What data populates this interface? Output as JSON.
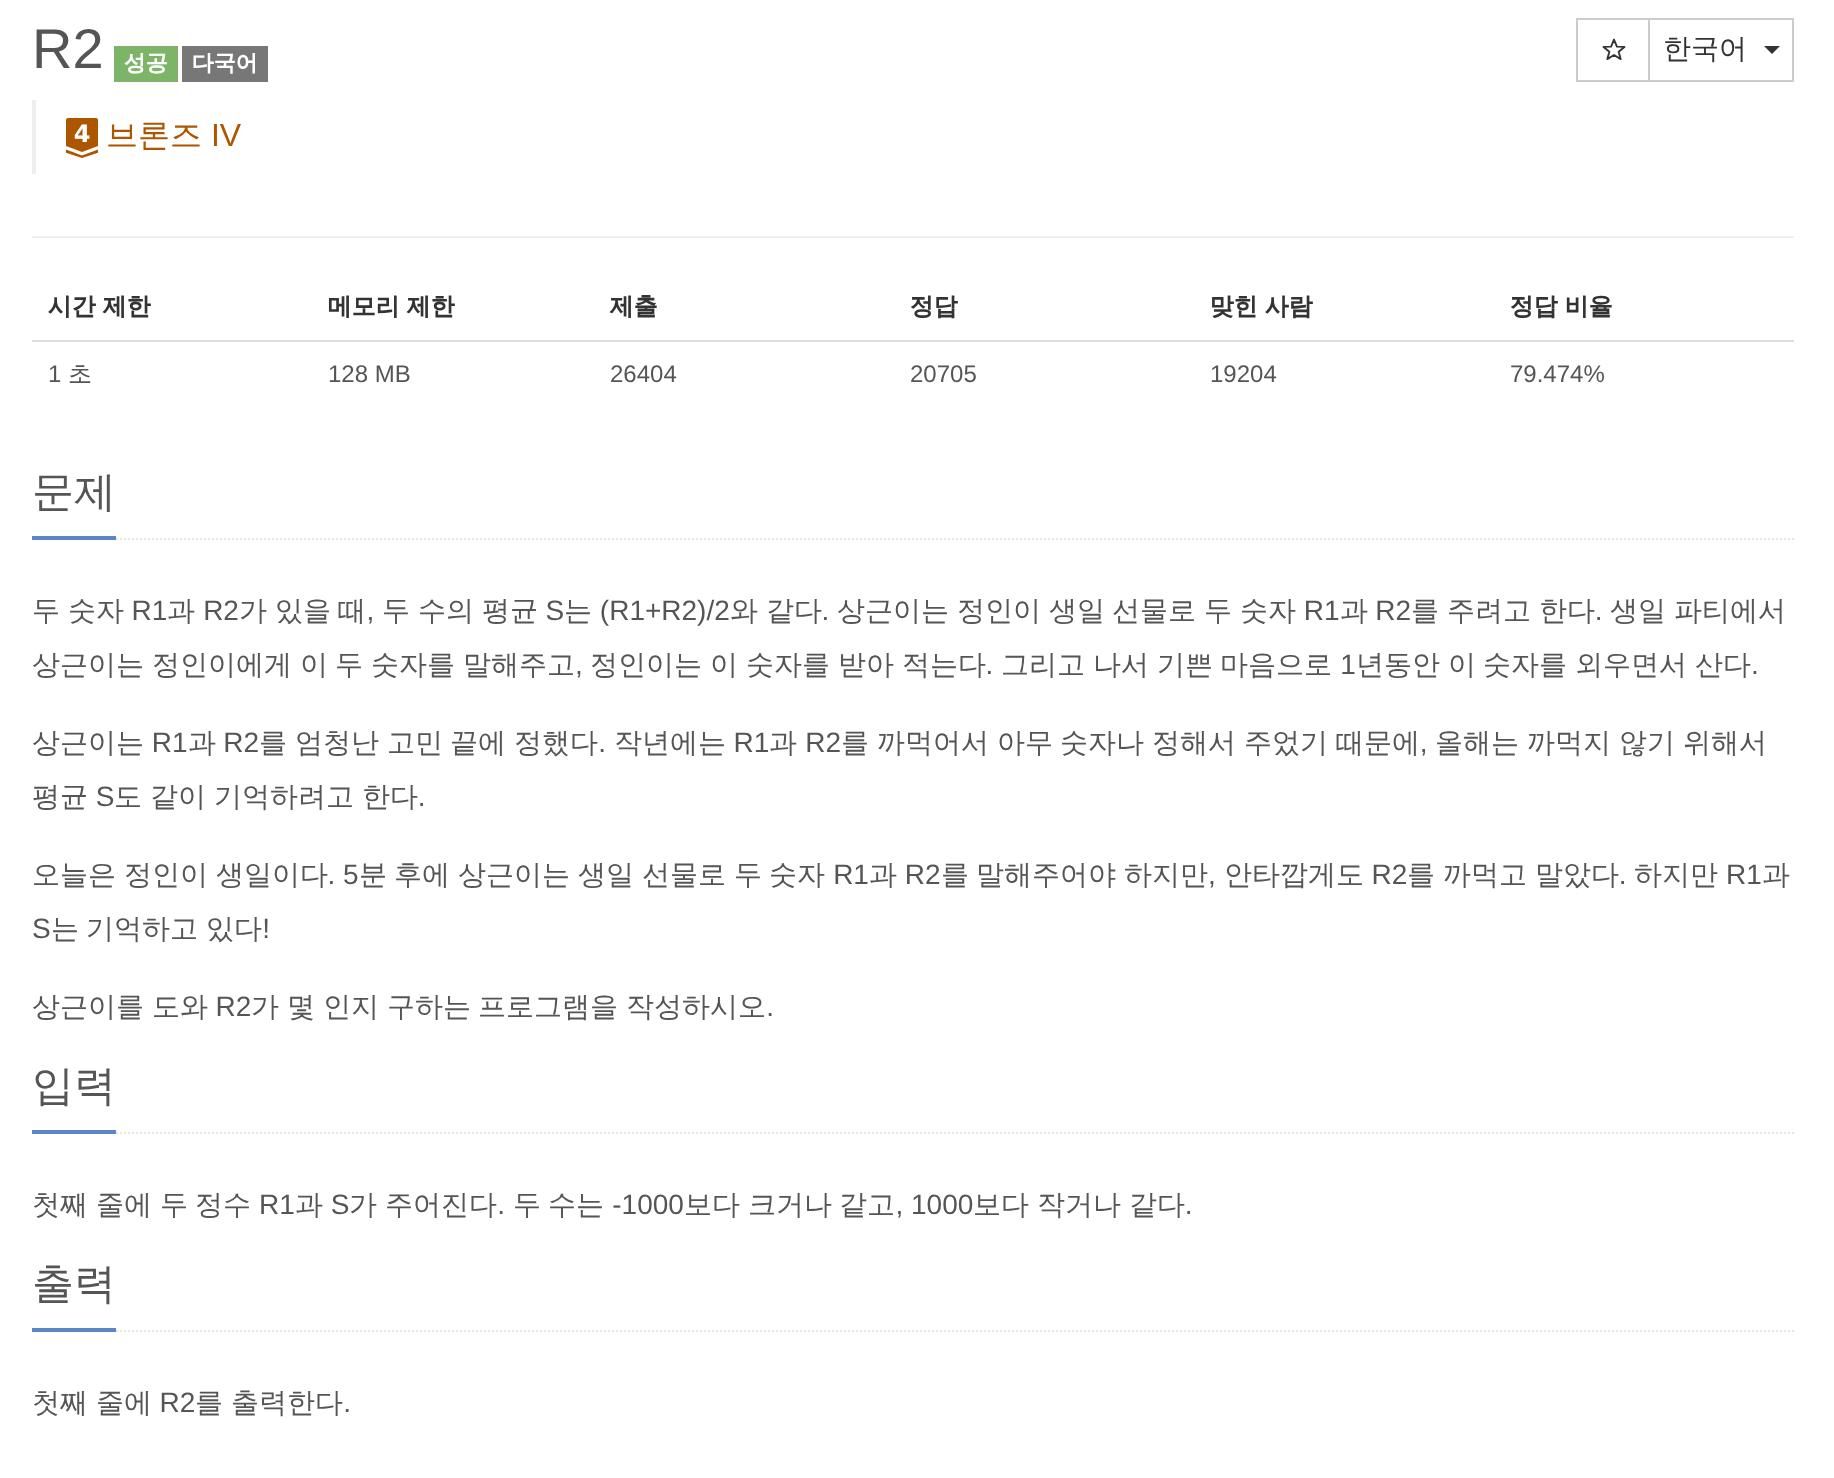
{
  "problem": {
    "title": "R2",
    "badges": [
      {
        "label": "성공",
        "kind": "solved"
      },
      {
        "label": "다국어",
        "kind": "multilang"
      }
    ],
    "tier": {
      "rank": "4",
      "label": "브론즈 IV",
      "kind": "bronze"
    }
  },
  "toolbar": {
    "language": "한국어"
  },
  "stats": {
    "columns": [
      "시간 제한",
      "메모리 제한",
      "제출",
      "정답",
      "맞힌 사람",
      "정답 비율"
    ],
    "rows": [
      [
        "1 초",
        "128 MB",
        "26404",
        "20705",
        "19204",
        "79.474%"
      ]
    ]
  },
  "sections": [
    {
      "heading": "문제",
      "paragraphs": [
        "두 숫자 R1과 R2가 있을 때, 두 수의 평균 S는 (R1+R2)/2와 같다. 상근이는 정인이 생일 선물로 두 숫자 R1과 R2를 주려고 한다. 생일 파티에서 상근이는 정인이에게 이 두 숫자를 말해주고, 정인이는 이 숫자를 받아 적는다. 그리고 나서 기쁜 마음으로 1년동안 이 숫자를 외우면서 산다.",
        "상근이는 R1과 R2를 엄청난 고민 끝에 정했다. 작년에는 R1과 R2를 까먹어서 아무 숫자나 정해서 주었기 때문에, 올해는 까먹지 않기 위해서 평균 S도 같이 기억하려고 한다.",
        "오늘은 정인이 생일이다. 5분 후에 상근이는 생일 선물로 두 숫자 R1과 R2를 말해주어야 하지만, 안타깝게도 R2를 까먹고 말았다. 하지만 R1과 S는 기억하고 있다!",
        "상근이를 도와 R2가 몇 인지 구하는 프로그램을 작성하시오."
      ]
    },
    {
      "heading": "입력",
      "paragraphs": [
        "첫째 줄에 두 정수 R1과 S가 주어진다. 두 수는 -1000보다 크거나 같고, 1000보다 작거나 같다."
      ]
    },
    {
      "heading": "출력",
      "paragraphs": [
        "첫째 줄에 R2를 출력한다."
      ]
    }
  ]
}
